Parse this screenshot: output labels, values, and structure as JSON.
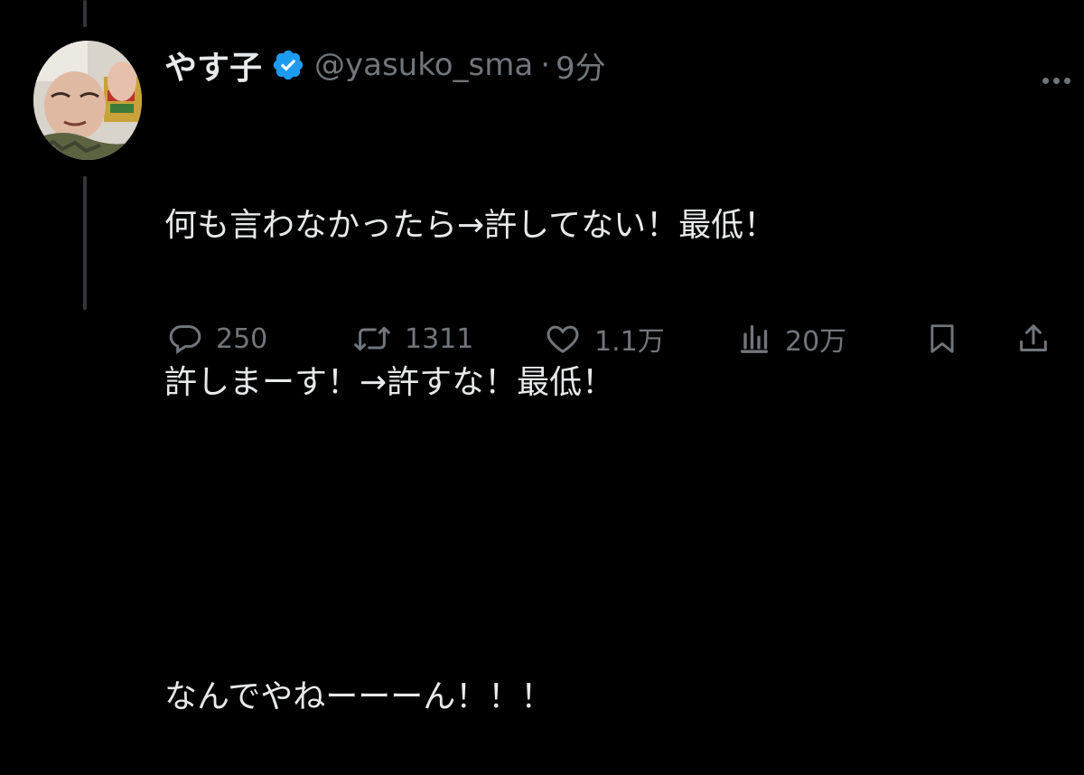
{
  "tweet": {
    "display_name": "やす子",
    "handle": "@yasuko_sma",
    "separator": "·",
    "time": "9分",
    "lines": [
      "何も言わなかったら→許してない！最低！",
      "許しまーす！→許すな！最低！",
      "",
      "なんでやねーーーん！！！"
    ]
  },
  "actions": {
    "replies": "250",
    "retweets": "1311",
    "likes": "1.1万",
    "views": "20万"
  },
  "colors": {
    "background": "#000000",
    "text": "#e7e9ea",
    "muted": "#71767b",
    "verified": "#1d9bf0",
    "thread_line": "#333639"
  },
  "icons": {
    "verified": "verified-badge-icon",
    "more": "more-horizontal-icon",
    "reply": "reply-bubble-icon",
    "retweet": "retweet-icon",
    "like": "heart-icon",
    "views": "views-bar-chart-icon",
    "bookmark": "bookmark-icon",
    "share": "share-upload-icon"
  }
}
